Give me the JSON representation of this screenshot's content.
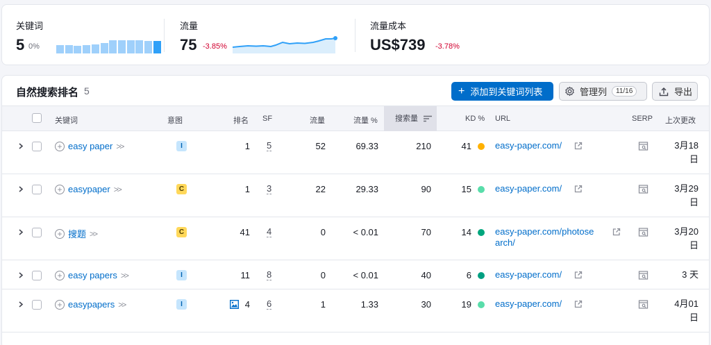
{
  "summary": {
    "keywords": {
      "label": "关键词",
      "value": "5",
      "change": "0%",
      "bars": [
        0.62,
        0.62,
        0.56,
        0.62,
        0.66,
        0.74,
        0.95,
        0.95,
        0.95,
        0.95,
        0.9,
        0.9
      ]
    },
    "traffic": {
      "label": "流量",
      "value": "75",
      "change": "-3.85%"
    },
    "cost": {
      "label": "流量成本",
      "value": "US$739",
      "change": "-3.78%"
    }
  },
  "panel": {
    "title": "自然搜索排名",
    "count": "5",
    "add_button": "添加到关键词列表",
    "manage_button": "管理列",
    "manage_count": "11/16",
    "export_button": "导出"
  },
  "headers": {
    "keyword": "关键词",
    "intent": "意图",
    "rank": "排名",
    "sf": "SF",
    "traffic": "流量",
    "traffic_pct": "流量 %",
    "volume": "搜索量",
    "kd": "KD %",
    "url": "URL",
    "serp": "SERP",
    "updated": "上次更改"
  },
  "rows": [
    {
      "keyword": "easy paper",
      "intent": "I",
      "rank": "1",
      "sf": "5",
      "traffic": "52",
      "traffic_pct": "69.33",
      "volume": "210",
      "kd": "41",
      "kd_color": "#ffb100",
      "url": "easy-paper.com/",
      "url2": "",
      "date1": "3月18",
      "date2": "日"
    },
    {
      "keyword": "easypaper",
      "intent": "C",
      "rank": "1",
      "sf": "3",
      "traffic": "22",
      "traffic_pct": "29.33",
      "volume": "90",
      "kd": "15",
      "kd_color": "#59ddaa",
      "url": "easy-paper.com/",
      "url2": "",
      "date1": "3月29",
      "date2": "日"
    },
    {
      "keyword": "搜题",
      "intent": "C",
      "rank": "41",
      "sf": "4",
      "traffic": "0",
      "traffic_pct": "< 0.01",
      "volume": "70",
      "kd": "14",
      "kd_color": "#00a67d",
      "url": "easy-paper.com/photose",
      "url2": "arch/",
      "date1": "3月20",
      "date2": "日"
    },
    {
      "keyword": "easy papers",
      "intent": "I",
      "rank": "11",
      "sf": "8",
      "traffic": "0",
      "traffic_pct": "< 0.01",
      "volume": "40",
      "kd": "6",
      "kd_color": "#009f81",
      "url": "easy-paper.com/",
      "url2": "",
      "date1": "3 天",
      "date2": ""
    },
    {
      "keyword": "easypapers",
      "intent": "I",
      "rank": "4",
      "sf": "6",
      "traffic": "1",
      "traffic_pct": "1.33",
      "volume": "30",
      "kd": "19",
      "kd_color": "#59ddaa",
      "url": "easy-paper.com/",
      "url2": "",
      "date1": "4月01",
      "date2": "日"
    }
  ],
  "icons": {
    "expand": "chevron-right-icon",
    "add": "plus-circle-icon",
    "more": "double-chevron-icon",
    "external": "external-link-icon",
    "serp": "serp-snapshot-icon",
    "gear": "gear-icon",
    "export": "upload-icon",
    "sort": "sort-desc-icon",
    "image": "image-icon"
  },
  "colors": {
    "accent": "#006dca",
    "negative": "#d1002f",
    "bar": "#9fd0fb",
    "bar_active": "#2fa0f8"
  }
}
